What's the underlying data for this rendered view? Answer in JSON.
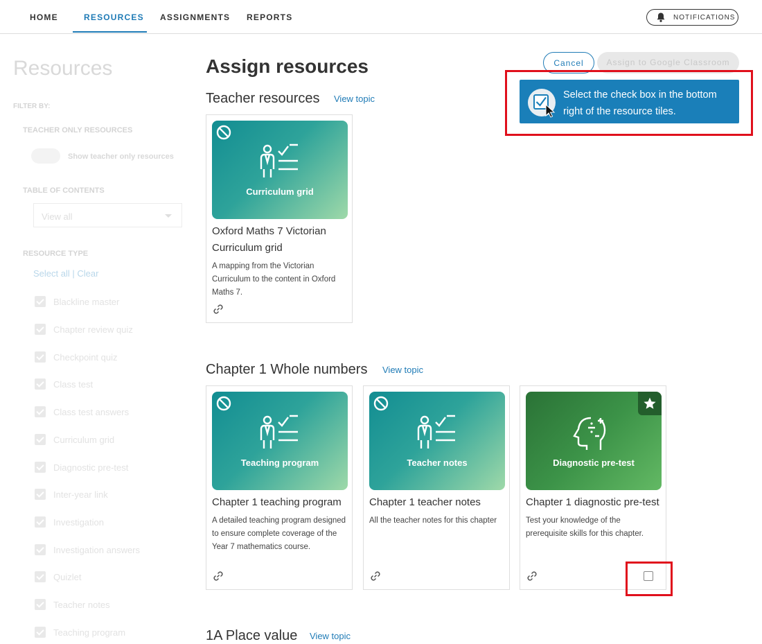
{
  "nav": {
    "items": [
      "HOME",
      "RESOURCES",
      "ASSIGNMENTS",
      "REPORTS"
    ],
    "active": "RESOURCES",
    "notifications_label": "NOTIFICATIONS"
  },
  "sidebar": {
    "title": "Resources",
    "filter_by": "FILTER BY:",
    "teacher_only_heading": "TEACHER ONLY RESOURCES",
    "teacher_only_toggle_label": "Show teacher only resources",
    "toc_heading": "TABLE OF CONTENTS",
    "toc_value": "View all",
    "resource_type_heading": "RESOURCE TYPE",
    "select_all": "Select all",
    "separator": "|",
    "clear": "Clear",
    "resource_types": [
      "Blackline master",
      "Chapter review quiz",
      "Checkpoint quiz",
      "Class test",
      "Class test answers",
      "Curriculum grid",
      "Diagnostic pre-test",
      "Inter-year link",
      "Investigation",
      "Investigation answers",
      "Quizlet",
      "Teacher notes",
      "Teaching program"
    ]
  },
  "main": {
    "title": "Assign resources",
    "cancel_label": "Cancel",
    "assign_label": "Assign to Google Classroom",
    "tip": "Select the check box in the bottom right of the resource tiles.",
    "view_topic": "View topic",
    "sections": [
      {
        "title": "Teacher resources",
        "cards": [
          {
            "thumb_label": "Curriculum grid",
            "title": "Oxford Maths 7 Victorian Curriculum grid",
            "description": "A mapping from the Victorian Curriculum to the content in Oxford Maths 7."
          }
        ]
      },
      {
        "title": "Chapter 1 Whole numbers",
        "cards": [
          {
            "thumb_label": "Teaching program",
            "title": "Chapter 1 teaching program",
            "description": "A detailed teaching program designed to ensure complete coverage of the Year 7 mathematics course."
          },
          {
            "thumb_label": "Teacher notes",
            "title": "Chapter 1 teacher notes",
            "description": "All the teacher notes for this chapter"
          },
          {
            "thumb_label": "Diagnostic pre-test",
            "title": "Chapter 1 diagnostic pre-test",
            "description": "Test your knowledge of the prerequisite skills for this chapter."
          }
        ]
      },
      {
        "title": "1A Place value"
      }
    ]
  },
  "colors": {
    "accent": "#1f7bb6",
    "highlight": "#e0101c",
    "tip_background": "#1a7fb9"
  }
}
